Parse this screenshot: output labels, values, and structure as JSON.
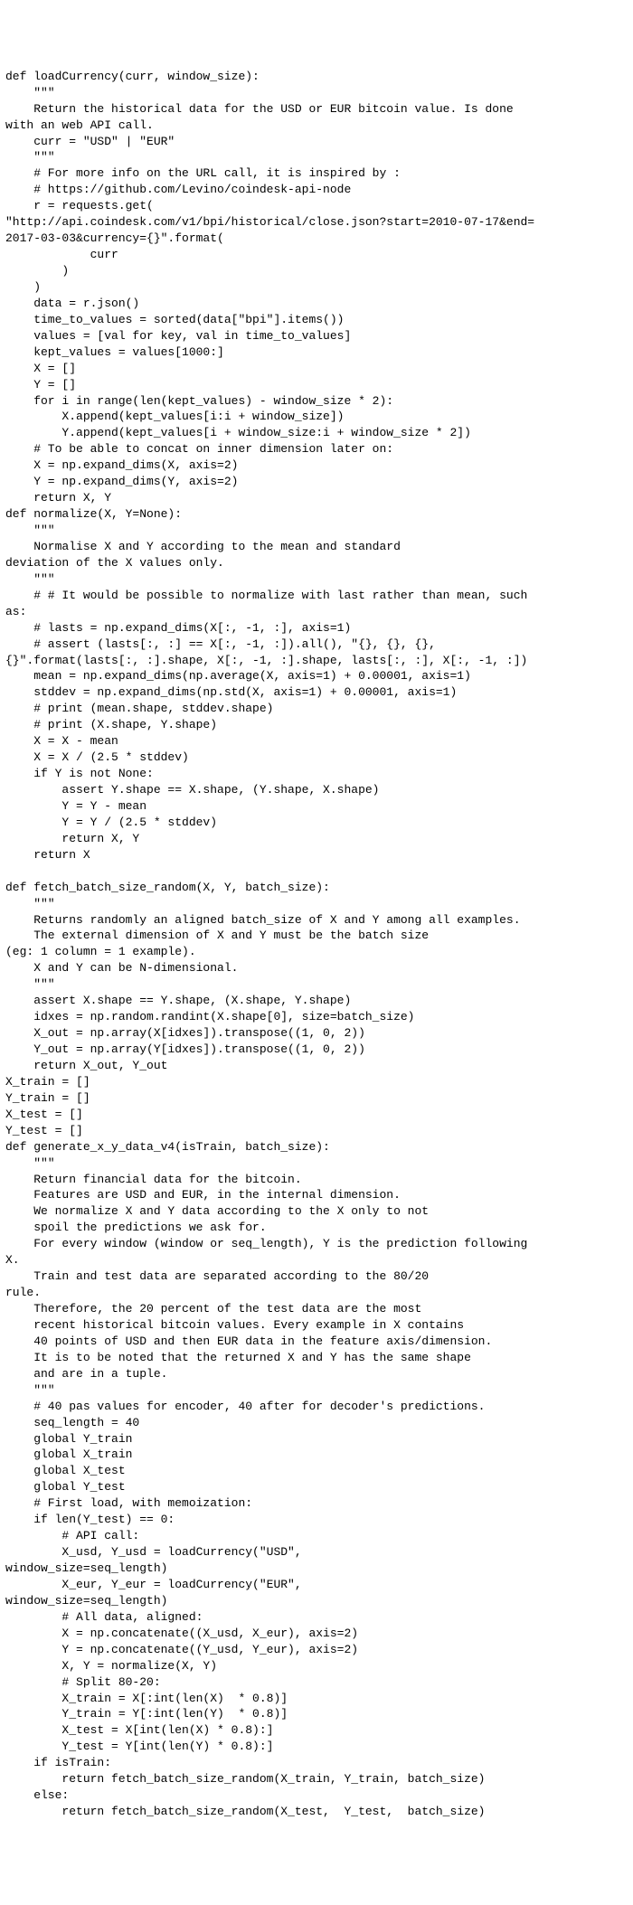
{
  "code": "def loadCurrency(curr, window_size):\n    \"\"\"\n    Return the historical data for the USD or EUR bitcoin value. Is done\nwith an web API call.\n    curr = \"USD\" | \"EUR\"\n    \"\"\"\n    # For more info on the URL call, it is inspired by :\n    # https://github.com/Levino/coindesk-api-node\n    r = requests.get(\n\"http://api.coindesk.com/v1/bpi/historical/close.json?start=2010-07-17&end=\n2017-03-03&currency={}\".format(\n            curr\n        )\n    )\n    data = r.json()\n    time_to_values = sorted(data[\"bpi\"].items())\n    values = [val for key, val in time_to_values]\n    kept_values = values[1000:]\n    X = []\n    Y = []\n    for i in range(len(kept_values) - window_size * 2):\n        X.append(kept_values[i:i + window_size])\n        Y.append(kept_values[i + window_size:i + window_size * 2])\n    # To be able to concat on inner dimension later on:\n    X = np.expand_dims(X, axis=2)\n    Y = np.expand_dims(Y, axis=2)\n    return X, Y\ndef normalize(X, Y=None):\n    \"\"\"\n    Normalise X and Y according to the mean and standard\ndeviation of the X values only.\n    \"\"\"\n    # # It would be possible to normalize with last rather than mean, such\nas:\n    # lasts = np.expand_dims(X[:, -1, :], axis=1)\n    # assert (lasts[:, :] == X[:, -1, :]).all(), \"{}, {}, {},\n{}\".format(lasts[:, :].shape, X[:, -1, :].shape, lasts[:, :], X[:, -1, :])\n    mean = np.expand_dims(np.average(X, axis=1) + 0.00001, axis=1)\n    stddev = np.expand_dims(np.std(X, axis=1) + 0.00001, axis=1)\n    # print (mean.shape, stddev.shape)\n    # print (X.shape, Y.shape)\n    X = X - mean\n    X = X / (2.5 * stddev)\n    if Y is not None:\n        assert Y.shape == X.shape, (Y.shape, X.shape)\n        Y = Y - mean\n        Y = Y / (2.5 * stddev)\n        return X, Y\n    return X\n\ndef fetch_batch_size_random(X, Y, batch_size):\n    \"\"\"\n    Returns randomly an aligned batch_size of X and Y among all examples.\n    The external dimension of X and Y must be the batch size\n(eg: 1 column = 1 example).\n    X and Y can be N-dimensional.\n    \"\"\"\n    assert X.shape == Y.shape, (X.shape, Y.shape)\n    idxes = np.random.randint(X.shape[0], size=batch_size)\n    X_out = np.array(X[idxes]).transpose((1, 0, 2))\n    Y_out = np.array(Y[idxes]).transpose((1, 0, 2))\n    return X_out, Y_out\nX_train = []\nY_train = []\nX_test = []\nY_test = []\ndef generate_x_y_data_v4(isTrain, batch_size):\n    \"\"\"\n    Return financial data for the bitcoin.\n    Features are USD and EUR, in the internal dimension.\n    We normalize X and Y data according to the X only to not\n    spoil the predictions we ask for.\n    For every window (window or seq_length), Y is the prediction following\nX.\n    Train and test data are separated according to the 80/20\nrule.\n    Therefore, the 20 percent of the test data are the most\n    recent historical bitcoin values. Every example in X contains\n    40 points of USD and then EUR data in the feature axis/dimension.\n    It is to be noted that the returned X and Y has the same shape\n    and are in a tuple.\n    \"\"\"\n    # 40 pas values for encoder, 40 after for decoder's predictions.\n    seq_length = 40\n    global Y_train\n    global X_train\n    global X_test\n    global Y_test\n    # First load, with memoization:\n    if len(Y_test) == 0:\n        # API call:\n        X_usd, Y_usd = loadCurrency(\"USD\",\nwindow_size=seq_length)\n        X_eur, Y_eur = loadCurrency(\"EUR\",\nwindow_size=seq_length)\n        # All data, aligned:\n        X = np.concatenate((X_usd, X_eur), axis=2)\n        Y = np.concatenate((Y_usd, Y_eur), axis=2)\n        X, Y = normalize(X, Y)\n        # Split 80-20:\n        X_train = X[:int(len(X)  * 0.8)]\n        Y_train = Y[:int(len(Y)  * 0.8)]\n        X_test = X[int(len(X) * 0.8):]\n        Y_test = Y[int(len(Y) * 0.8):]\n    if isTrain:\n        return fetch_batch_size_random(X_train, Y_train, batch_size)\n    else:\n        return fetch_batch_size_random(X_test,  Y_test,  batch_size)"
}
